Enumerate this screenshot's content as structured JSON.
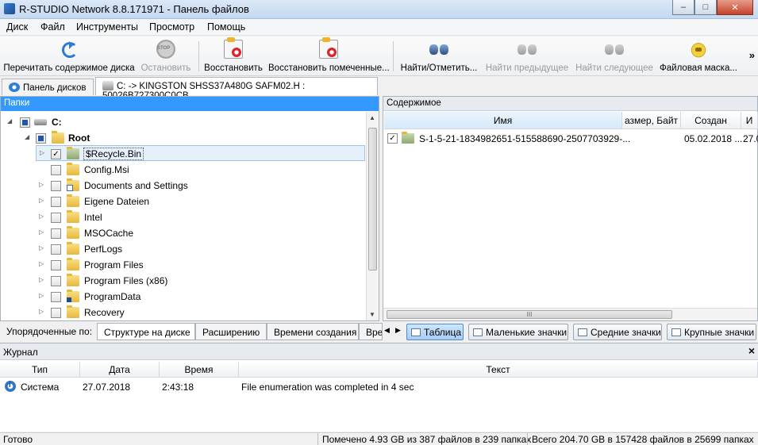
{
  "window": {
    "title": "R-STUDIO Network 8.8.171971 - Панель файлов",
    "min": "–",
    "max": "□",
    "close": "✕"
  },
  "menu": [
    "Диск",
    "Файл",
    "Инструменты",
    "Просмотр",
    "Помощь"
  ],
  "toolbar": {
    "rescan": "Перечитать содержимое диска",
    "stop": "Остановить",
    "restore": "Восстановить",
    "restore_marked": "Восстановить помеченные...",
    "find_mark": "Найти/Отметить...",
    "find_prev": "Найти предыдущее",
    "find_next": "Найти следующее",
    "file_mask": "Файловая маска...",
    "more": "»"
  },
  "tabs": {
    "disk_panel": "Панель дисков",
    "path": "C: -> KINGSTON SHSS37A480G SAFM02.H : 50026B727300C0CB"
  },
  "folders_panel": {
    "header": "Папки",
    "drive": "C:",
    "root": "Root",
    "items": [
      {
        "name": "$Recycle.Bin",
        "checked": "✓"
      },
      {
        "name": "Config.Msi"
      },
      {
        "name": "Documents and Settings"
      },
      {
        "name": "Eigene Dateien"
      },
      {
        "name": "Intel"
      },
      {
        "name": "MSOCache"
      },
      {
        "name": "PerfLogs"
      },
      {
        "name": "Program Files"
      },
      {
        "name": "Program Files (x86)"
      },
      {
        "name": "ProgramData"
      },
      {
        "name": "Recovery"
      }
    ]
  },
  "contents_panel": {
    "header": "Содержимое",
    "columns": {
      "name": "Имя",
      "size": "азмер, Байт",
      "created": "Создан",
      "more": "И"
    },
    "rows": [
      {
        "checked": "✓",
        "name": "S-1-5-21-1834982651-515588690-2507703929-...",
        "created": "05.02.2018 ...",
        "more": "27.0"
      }
    ],
    "hscroll_grip": "III"
  },
  "sortbar": {
    "label": "Упорядоченные по:",
    "tabs": [
      "Структуре на диске",
      "Расширению",
      "Времени создания",
      "Вре"
    ],
    "views": [
      "Таблица",
      "Маленькие значки",
      "Средние значки",
      "Крупные значки"
    ]
  },
  "journal": {
    "title": "Журнал",
    "close": "×",
    "columns": [
      "Тип",
      "Дата",
      "Время",
      "Текст"
    ],
    "entries": [
      {
        "type": "Система",
        "date": "27.07.2018",
        "time": "2:43:18",
        "text": "File enumeration was completed in 4 sec"
      }
    ]
  },
  "status": {
    "ready": "Готово",
    "marked": "Помечено 4.93 GB из 387 файлов в 239 папках",
    "total": "Всего 204.70 GB в 157428 файлов в 25699 папках"
  },
  "colors": {
    "selection_header": "#3399ff",
    "accent": "#2b7bd4"
  }
}
